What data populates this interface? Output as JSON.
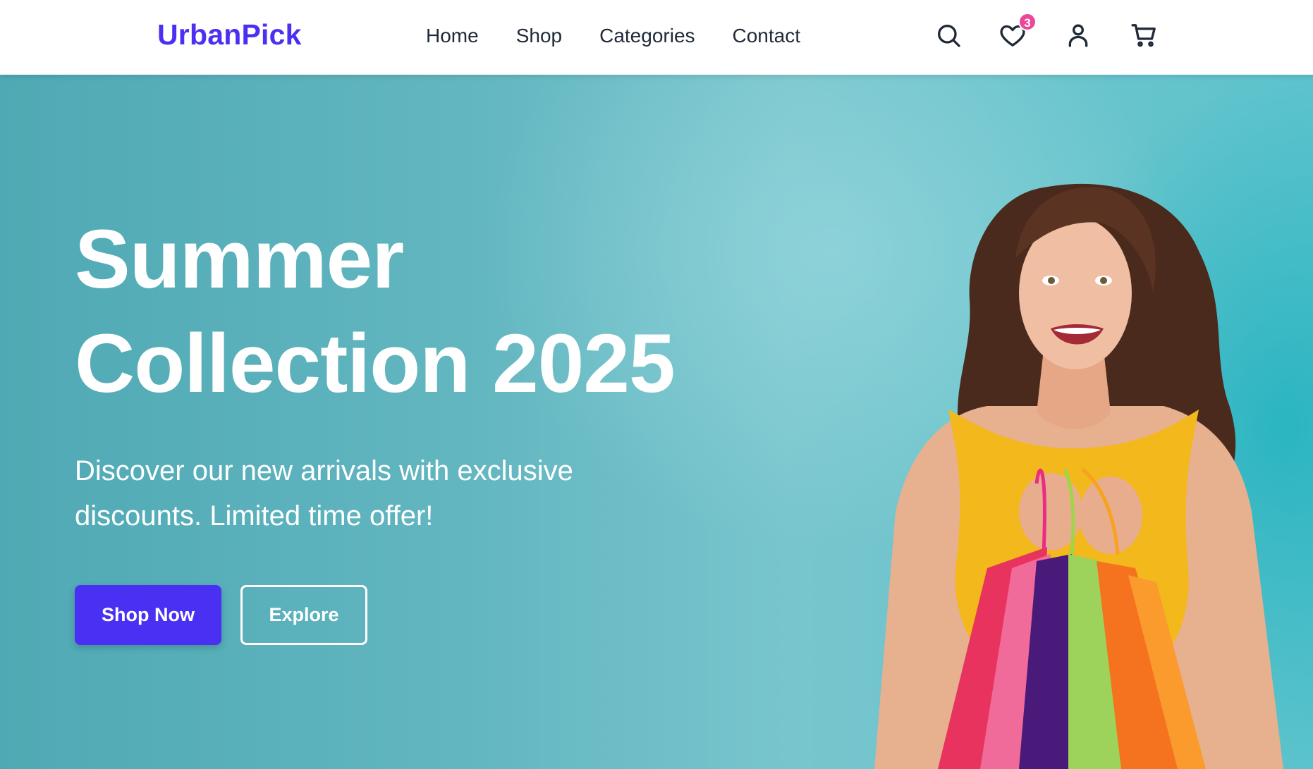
{
  "brand": {
    "name": "UrbanPick",
    "accent": "#4a30f2"
  },
  "nav": {
    "items": [
      {
        "label": "Home"
      },
      {
        "label": "Shop"
      },
      {
        "label": "Categories"
      },
      {
        "label": "Contact"
      }
    ]
  },
  "header_icons": {
    "search": "search-icon",
    "wishlist": "heart-icon",
    "account": "user-icon",
    "cart": "cart-icon",
    "wishlist_count": "3",
    "badge_color": "#ec4899"
  },
  "hero": {
    "title_line1": "Summer",
    "title_line2": "Collection 2025",
    "subtitle": "Discover our new arrivals with exclusive discounts. Limited time offer!",
    "primary_button": "Shop Now",
    "secondary_button": "Explore",
    "background_color": "#5fb7c1"
  }
}
